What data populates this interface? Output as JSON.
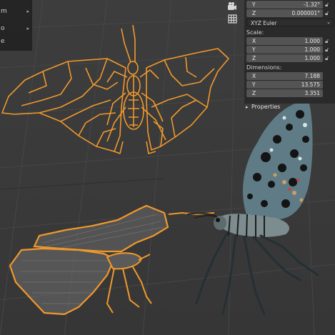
{
  "left_menu": {
    "items": [
      {
        "label": "m"
      },
      {
        "label": "o"
      },
      {
        "label": "e"
      }
    ]
  },
  "tools": {
    "camera_icon": "camera-icon",
    "grid_icon": "grid-icon"
  },
  "transform_panel": {
    "rotation": {
      "y": {
        "axis": "Y",
        "value": "-1.32°"
      },
      "z": {
        "axis": "Z",
        "value": "0.000001°"
      },
      "mode": "XYZ Euler"
    },
    "scale": {
      "label": "Scale:",
      "x": {
        "axis": "X",
        "value": "1.000"
      },
      "y": {
        "axis": "Y",
        "value": "1.000"
      },
      "z": {
        "axis": "Z",
        "value": "1.000"
      }
    },
    "dimensions": {
      "label": "Dimensions:",
      "x": {
        "axis": "X",
        "value": "7.188"
      },
      "y": {
        "axis": "Y",
        "value": "13.575"
      },
      "z": {
        "axis": "Z",
        "value": "3.351"
      }
    }
  },
  "properties": {
    "label": "Properties"
  },
  "colors": {
    "selection_orange": "#f5a030",
    "panel_bg": "#2a2a2a",
    "field_bg": "#545454",
    "viewport_bg": "#3a3a3a"
  }
}
